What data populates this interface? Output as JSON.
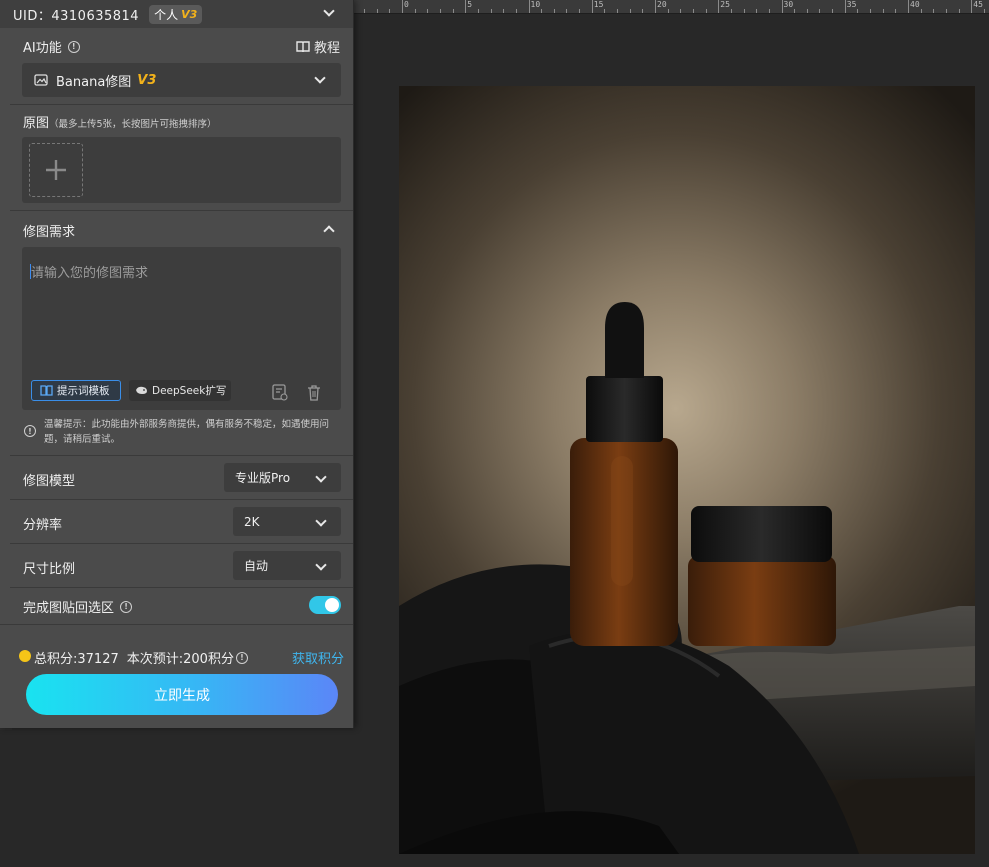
{
  "header": {
    "uid_text": "UID：4310635814",
    "account_type": "个人",
    "version_badge": "V3"
  },
  "ai_function": {
    "label": "AI功能",
    "tutorial_label": "教程",
    "selected_function": "Banana修图",
    "selected_version": "V3"
  },
  "original": {
    "label": "原图",
    "hint": "（最多上传5张，长按图片可拖拽排序）"
  },
  "edit_request": {
    "label": "修图需求",
    "placeholder": "请输入您的修图需求",
    "template_button": "提示词模板",
    "deepseek_button": "DeepSeek扩写"
  },
  "notice": {
    "text": "温馨提示：此功能由外部服务商提供，偶有服务不稳定，如遇使用问题，请稍后重试。"
  },
  "model": {
    "label": "修图模型",
    "value": "专业版Pro"
  },
  "resolution": {
    "label": "分辨率",
    "value": "2K"
  },
  "aspect": {
    "label": "尺寸比例",
    "value": "自动"
  },
  "paste_back": {
    "label": "完成图贴回选区",
    "enabled": true
  },
  "credits": {
    "total": "总积分:37127",
    "estimate": "本次预计:200积分",
    "get_link": "获取积分"
  },
  "generate_button": "立即生成",
  "ruler_labels": [
    "0",
    "5",
    "10",
    "15",
    "20",
    "25",
    "30",
    "35",
    "40",
    "45"
  ],
  "colors": {
    "accent": "#31c7e8",
    "version": "#f2b21b",
    "link": "#3fb7f0",
    "coin": "#f5c518"
  }
}
